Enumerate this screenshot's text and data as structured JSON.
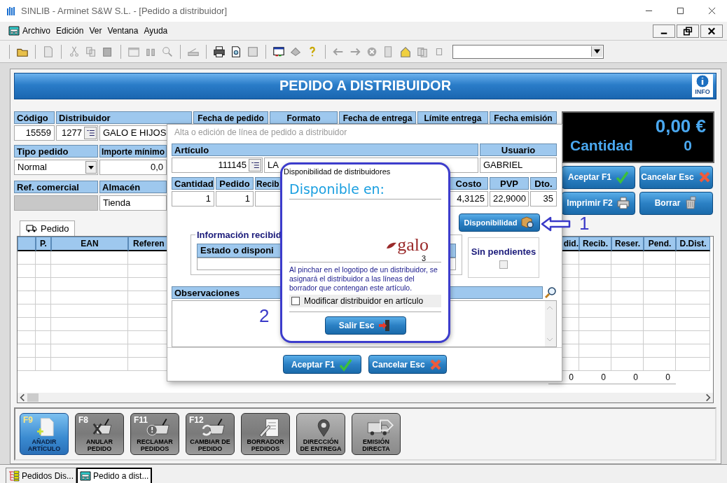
{
  "window": {
    "title": "SINLIB - Arminet S&W S.L. - [Pedido a distribuidor]"
  },
  "menu": [
    "Archivo",
    "Edición",
    "Ver",
    "Ventana",
    "Ayuda"
  ],
  "form": {
    "title": "PEDIDO A DISTRIBUIDOR",
    "info_label": "INFO",
    "codigo": {
      "label": "Código",
      "value": "15559"
    },
    "distribuidor": {
      "label": "Distribuidor",
      "code": "1277",
      "name": "GALO E HIJOS"
    },
    "date_headers": [
      "Fecha de pedido",
      "Formato",
      "Fecha de entrega",
      "Límite entrega",
      "Fecha emisión"
    ],
    "tipo_pedido": {
      "label": "Tipo pedido",
      "value": "Normal"
    },
    "importe_minimo": {
      "label": "Importe mínimo",
      "value": "0,0"
    },
    "ref_comercial": {
      "label": "Ref. comercial"
    },
    "almacen": {
      "label": "Almacén",
      "value": "Tienda"
    }
  },
  "totals_display": {
    "amount": "0,00 €",
    "quantity_label": "Cantidad",
    "quantity": "0"
  },
  "side_buttons": [
    {
      "label": "Aceptar F1",
      "kind": "check"
    },
    {
      "label": "Cancelar Esc",
      "kind": "cross"
    },
    {
      "label": "Imprimir F2",
      "kind": "printer"
    },
    {
      "label": "Borrar",
      "kind": "trash"
    }
  ],
  "tabs": [
    {
      "label": "Pedido",
      "selected": true
    }
  ],
  "table": {
    "columns": [
      "P.",
      "EAN",
      "Referen",
      "did.",
      "Recib.",
      "Reser.",
      "Pend.",
      "D.Dist."
    ],
    "totals": [
      "0",
      "0",
      "0",
      "0"
    ]
  },
  "actions": [
    {
      "key": "F9",
      "lines": [
        "AÑADIR",
        "ARTÍCULO"
      ],
      "kind": "add",
      "selected": true,
      "disabled": false
    },
    {
      "key": "F8",
      "lines": [
        "ANULAR",
        "PEDIDO"
      ],
      "kind": "cancel",
      "selected": false,
      "disabled": false
    },
    {
      "key": "F11",
      "lines": [
        "RECLAMAR",
        "PEDIDOS"
      ],
      "kind": "claim",
      "selected": false,
      "disabled": false
    },
    {
      "key": "F12",
      "lines": [
        "CAMBIAR DE",
        "PEDIDO"
      ],
      "kind": "change",
      "selected": false,
      "disabled": false
    },
    {
      "lines": [
        "BORRADOR",
        "PEDIDOS"
      ],
      "kind": "draft",
      "selected": false,
      "disabled": false
    },
    {
      "lines": [
        "DIRECCIÓN",
        "DE ENTREGA"
      ],
      "kind": "pin",
      "selected": false,
      "disabled": true
    },
    {
      "lines": [
        "EMISIÓN",
        "DIRECTA"
      ],
      "kind": "truck",
      "selected": false,
      "disabled": true
    }
  ],
  "line_dialog": {
    "title": "Alta o edición de línea de pedido a distribuidor",
    "articulo_label": "Artículo",
    "usuario_label": "Usuario",
    "articulo_code": "111145",
    "articulo_title": "LA",
    "usuario": "GABRIEL",
    "qty_columns": [
      {
        "label": "Cantidad",
        "value": "1"
      },
      {
        "label": "Pedido",
        "value": "1"
      },
      {
        "label": "Recib"
      }
    ],
    "price_columns": [
      {
        "label": "Costo",
        "value": "4,3125"
      },
      {
        "label": "PVP",
        "value": "22,9000"
      },
      {
        "label": "Dto.",
        "value": "35"
      }
    ],
    "availability_button": "Disponibilidad",
    "info_group": "Información recibid",
    "status_header": "Estado o disponi",
    "sin_pendientes": {
      "label": "Sin pendientes",
      "checked": false
    },
    "observaciones_label": "Observaciones",
    "buttons": [
      {
        "label": "Aceptar F1",
        "kind": "check"
      },
      {
        "label": "Cancelar Esc",
        "kind": "cross"
      }
    ]
  },
  "availability_popup": {
    "title": "Disponibilidad de distribuidores",
    "heading": "Disponible en:",
    "distributors": [
      {
        "logo": "galo",
        "count": "3"
      }
    ],
    "note": "Al pinchar en el logotipo de un distribuidor, se asignará el distribuidor a las líneas del borrador que contengan este artículo.",
    "modify": {
      "label": "Modificar distribuidor en artículo",
      "checked": false
    },
    "exit_button": "Salir Esc"
  },
  "annotations": [
    {
      "label": "1",
      "kind": "arrow"
    },
    {
      "label": "2",
      "kind": "plain"
    }
  ],
  "taskbar": [
    {
      "label": "Pedidos Dis...",
      "selected": false
    },
    {
      "label": "Pedido a dist...",
      "selected": true
    }
  ]
}
